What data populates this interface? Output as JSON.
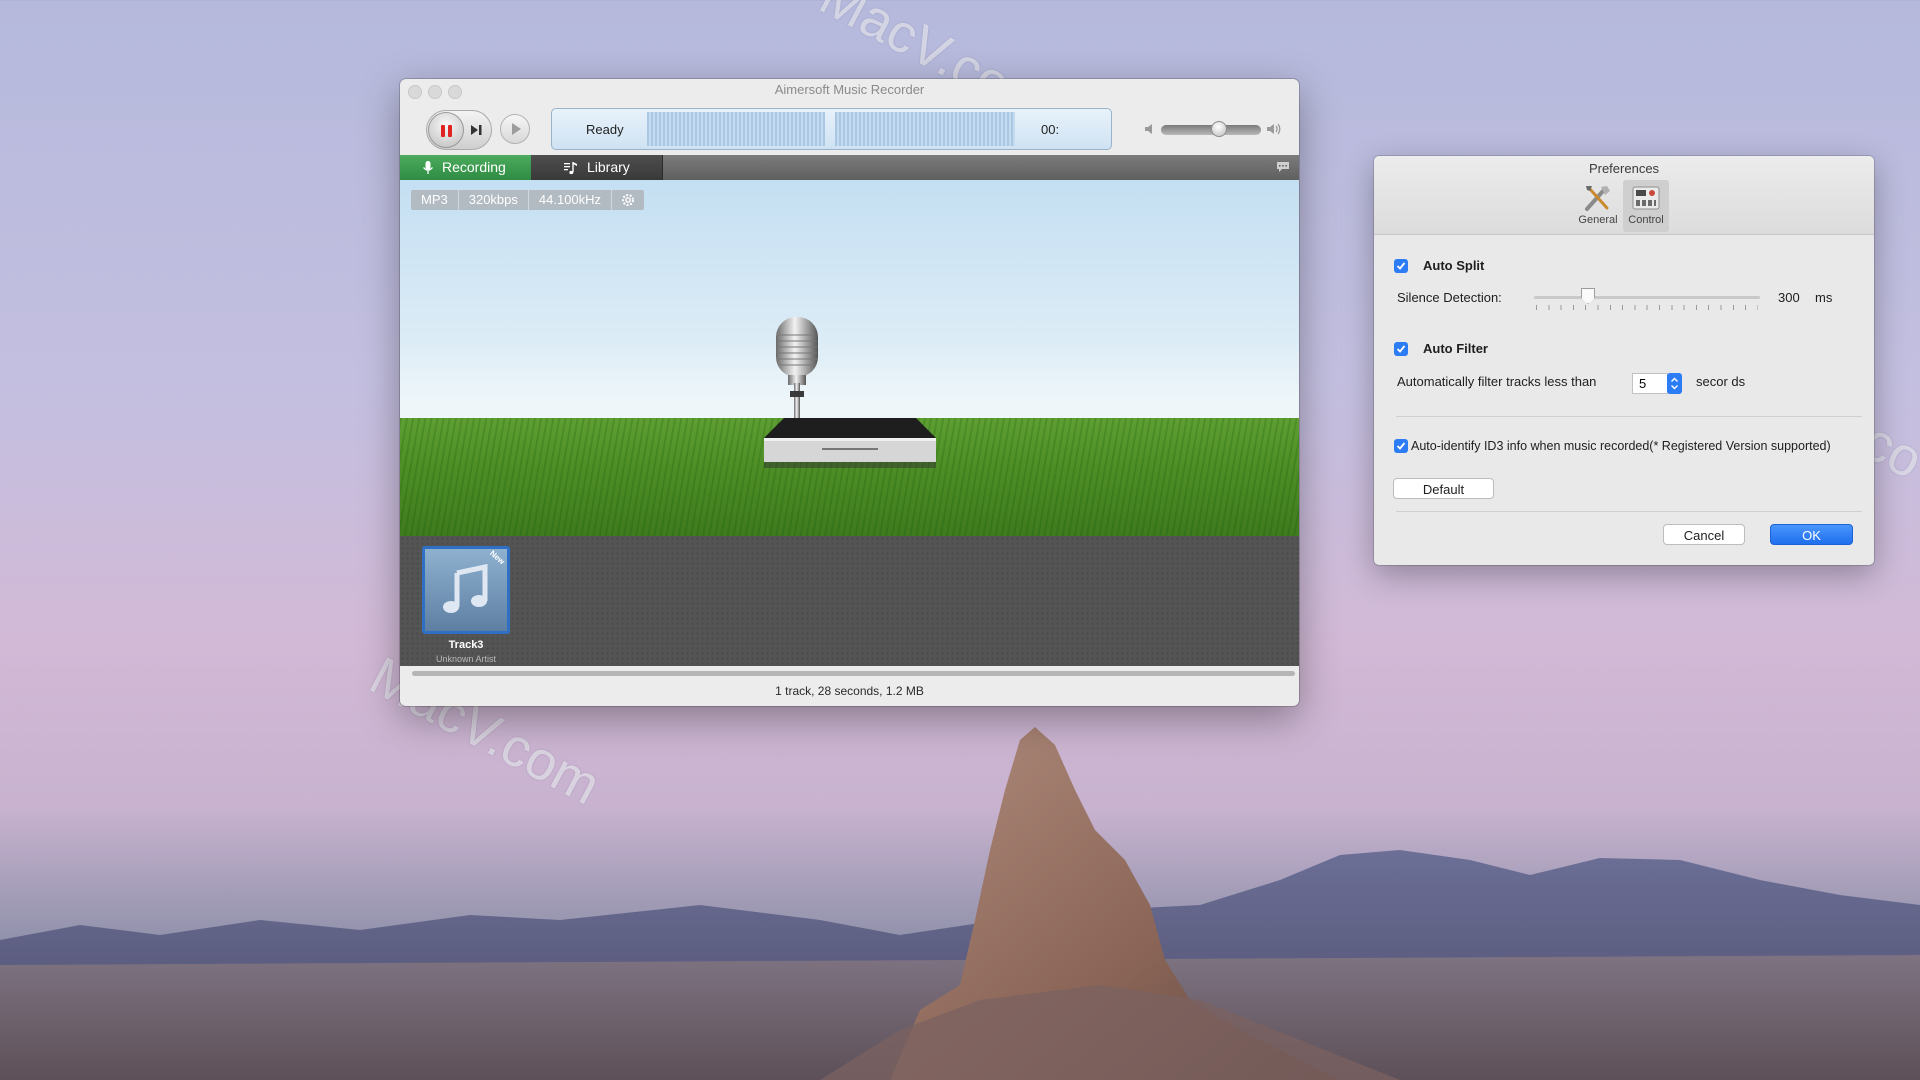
{
  "desktop": {
    "watermark_top": "MacV.com",
    "watermark_bottom": "MacV.com",
    "watermark_right": "MacV.co"
  },
  "main_window": {
    "title": "Aimersoft  Music Recorder",
    "lcd": {
      "status": "Ready",
      "time": "00:"
    },
    "volume_level": 0.7,
    "tabs": [
      {
        "label": "Recording",
        "icon": "microphone-icon",
        "active": true
      },
      {
        "label": "Library",
        "icon": "music-note-icon",
        "active": false
      }
    ],
    "format": {
      "codec": "MP3",
      "bitrate": "320kbps",
      "sample_rate": "44.100kHz"
    },
    "tracks": [
      {
        "name": "Track3",
        "artist": "Unknown Artist",
        "badge": "New"
      }
    ],
    "status": "1 track, 28 seconds, 1.2 MB",
    "colors": {
      "recording_tab": "#2e8c43",
      "record_button": "#e02424"
    }
  },
  "preferences": {
    "title": "Preferences",
    "tabs": [
      {
        "label": "General",
        "icon": "tools-icon",
        "active": false
      },
      {
        "label": "Control",
        "icon": "control-panel-icon",
        "active": true
      }
    ],
    "auto_split": {
      "label": "Auto Split",
      "checked": true,
      "silence_label": "Silence Detection:",
      "silence_value": "300",
      "silence_unit": "ms"
    },
    "auto_filter": {
      "label": "Auto Filter",
      "checked": true,
      "filter_label": "Automatically filter tracks less than",
      "filter_value": "5",
      "filter_unit": "secor ds"
    },
    "id3": {
      "label": "Auto-identify ID3 info when music recorded(* Registered Version supported)",
      "checked": true
    },
    "buttons": {
      "default": "Default",
      "cancel": "Cancel",
      "ok": "OK"
    },
    "colors": {
      "accent": "#2c7cf6"
    }
  }
}
